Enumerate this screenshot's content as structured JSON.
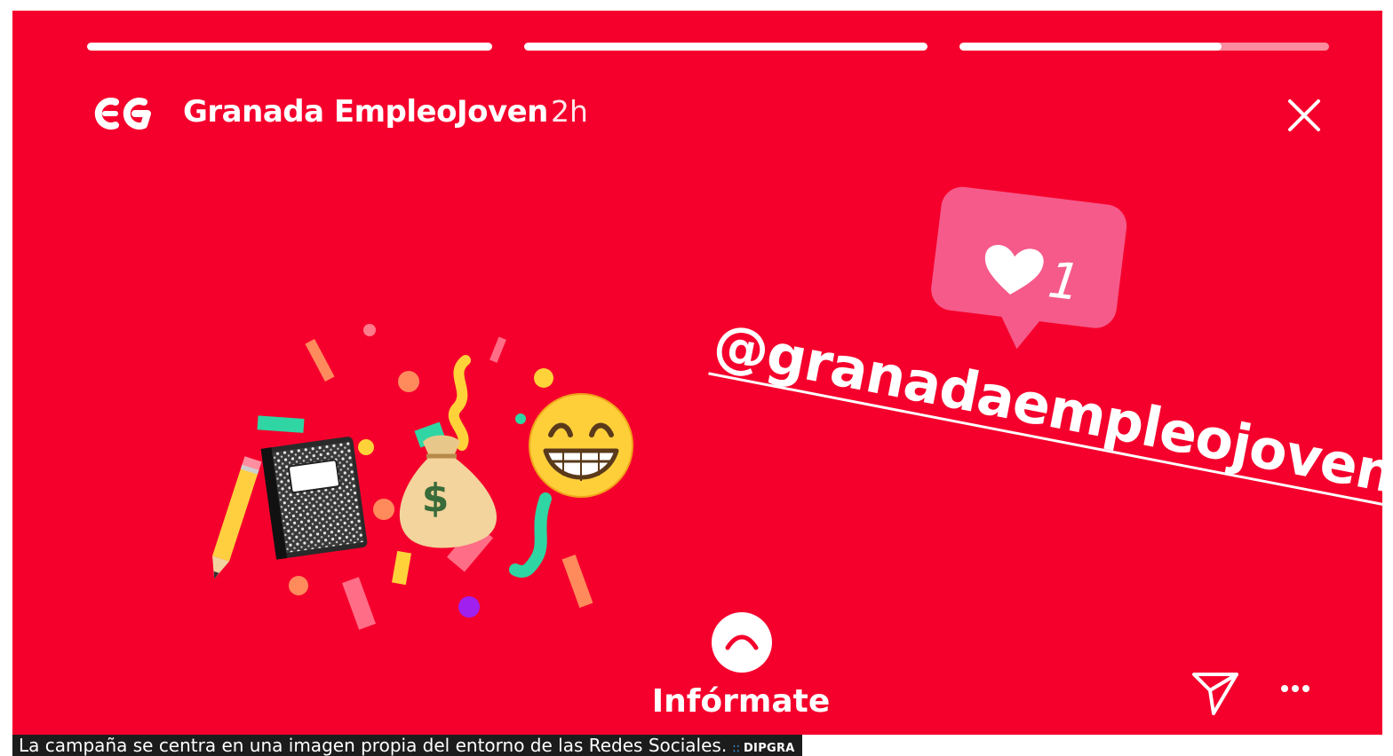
{
  "story": {
    "progress": [
      1.0,
      1.0,
      0.71
    ],
    "account_name": "Granada EmpleoJoven",
    "timestamp": "2h",
    "like_count": "1",
    "mention": "@granadaempleojoven",
    "swipe_up_label": "Infórmate",
    "background_color": "#f5002c",
    "icons": {
      "logo": "granada-empleojoven-logo",
      "close": "close-icon",
      "heart": "heart-icon",
      "swipe": "chevron-up-icon",
      "send": "send-icon",
      "more": "more-icon"
    }
  },
  "caption": {
    "text": "La campaña se centra en una imagen propia del entorno de las Redes Sociales.",
    "credit": "DIPGRA"
  }
}
